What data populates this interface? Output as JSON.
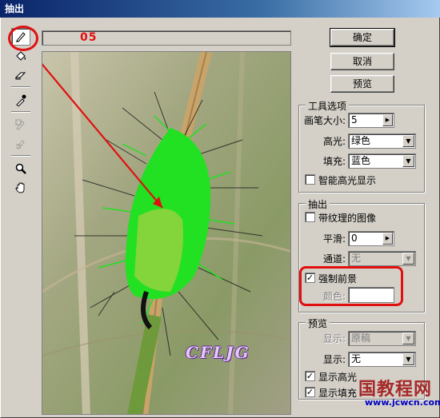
{
  "window": {
    "title": "抽出"
  },
  "toolbar": {
    "tools": [
      "edge-highlighter-tool",
      "fill-tool",
      "eraser-tool",
      "eyedropper-tool",
      "cleanup-tool",
      "edge-touchup-tool",
      "zoom-tool",
      "hand-tool"
    ],
    "step_label": "05"
  },
  "buttons": {
    "ok": "确定",
    "cancel": "取消",
    "preview": "预览"
  },
  "tool_options": {
    "title": "工具选项",
    "brush_size_label": "画笔大小:",
    "brush_size_value": "5",
    "highlight_label": "高光:",
    "highlight_value": "绿色",
    "fill_label": "填充:",
    "fill_value": "蓝色",
    "smart_highlight_label": "智能高光显示",
    "smart_highlight_checked": false
  },
  "extraction": {
    "title": "抽出",
    "textured_label": "带纹理的图像",
    "textured_checked": false,
    "smooth_label": "平滑:",
    "smooth_value": "0",
    "channel_label": "通道:",
    "channel_value": "无",
    "force_fg_label": "强制前景",
    "force_fg_checked": true,
    "color_label": "颜色:"
  },
  "preview_group": {
    "title": "预览",
    "show_label": "显示:",
    "show_value": "原稿",
    "display_label": "显示:",
    "display_value": "无",
    "show_highlight_label": "显示高光",
    "show_highlight_checked": true,
    "show_fill_label": "显示填充",
    "show_fill_checked": true
  },
  "watermark": {
    "site_cn": "国教程网",
    "site_url": "www.jcwcn.com",
    "logo_text": "CFLJG"
  },
  "colors": {
    "highlight": "#22e022",
    "annotation": "#e01010"
  }
}
